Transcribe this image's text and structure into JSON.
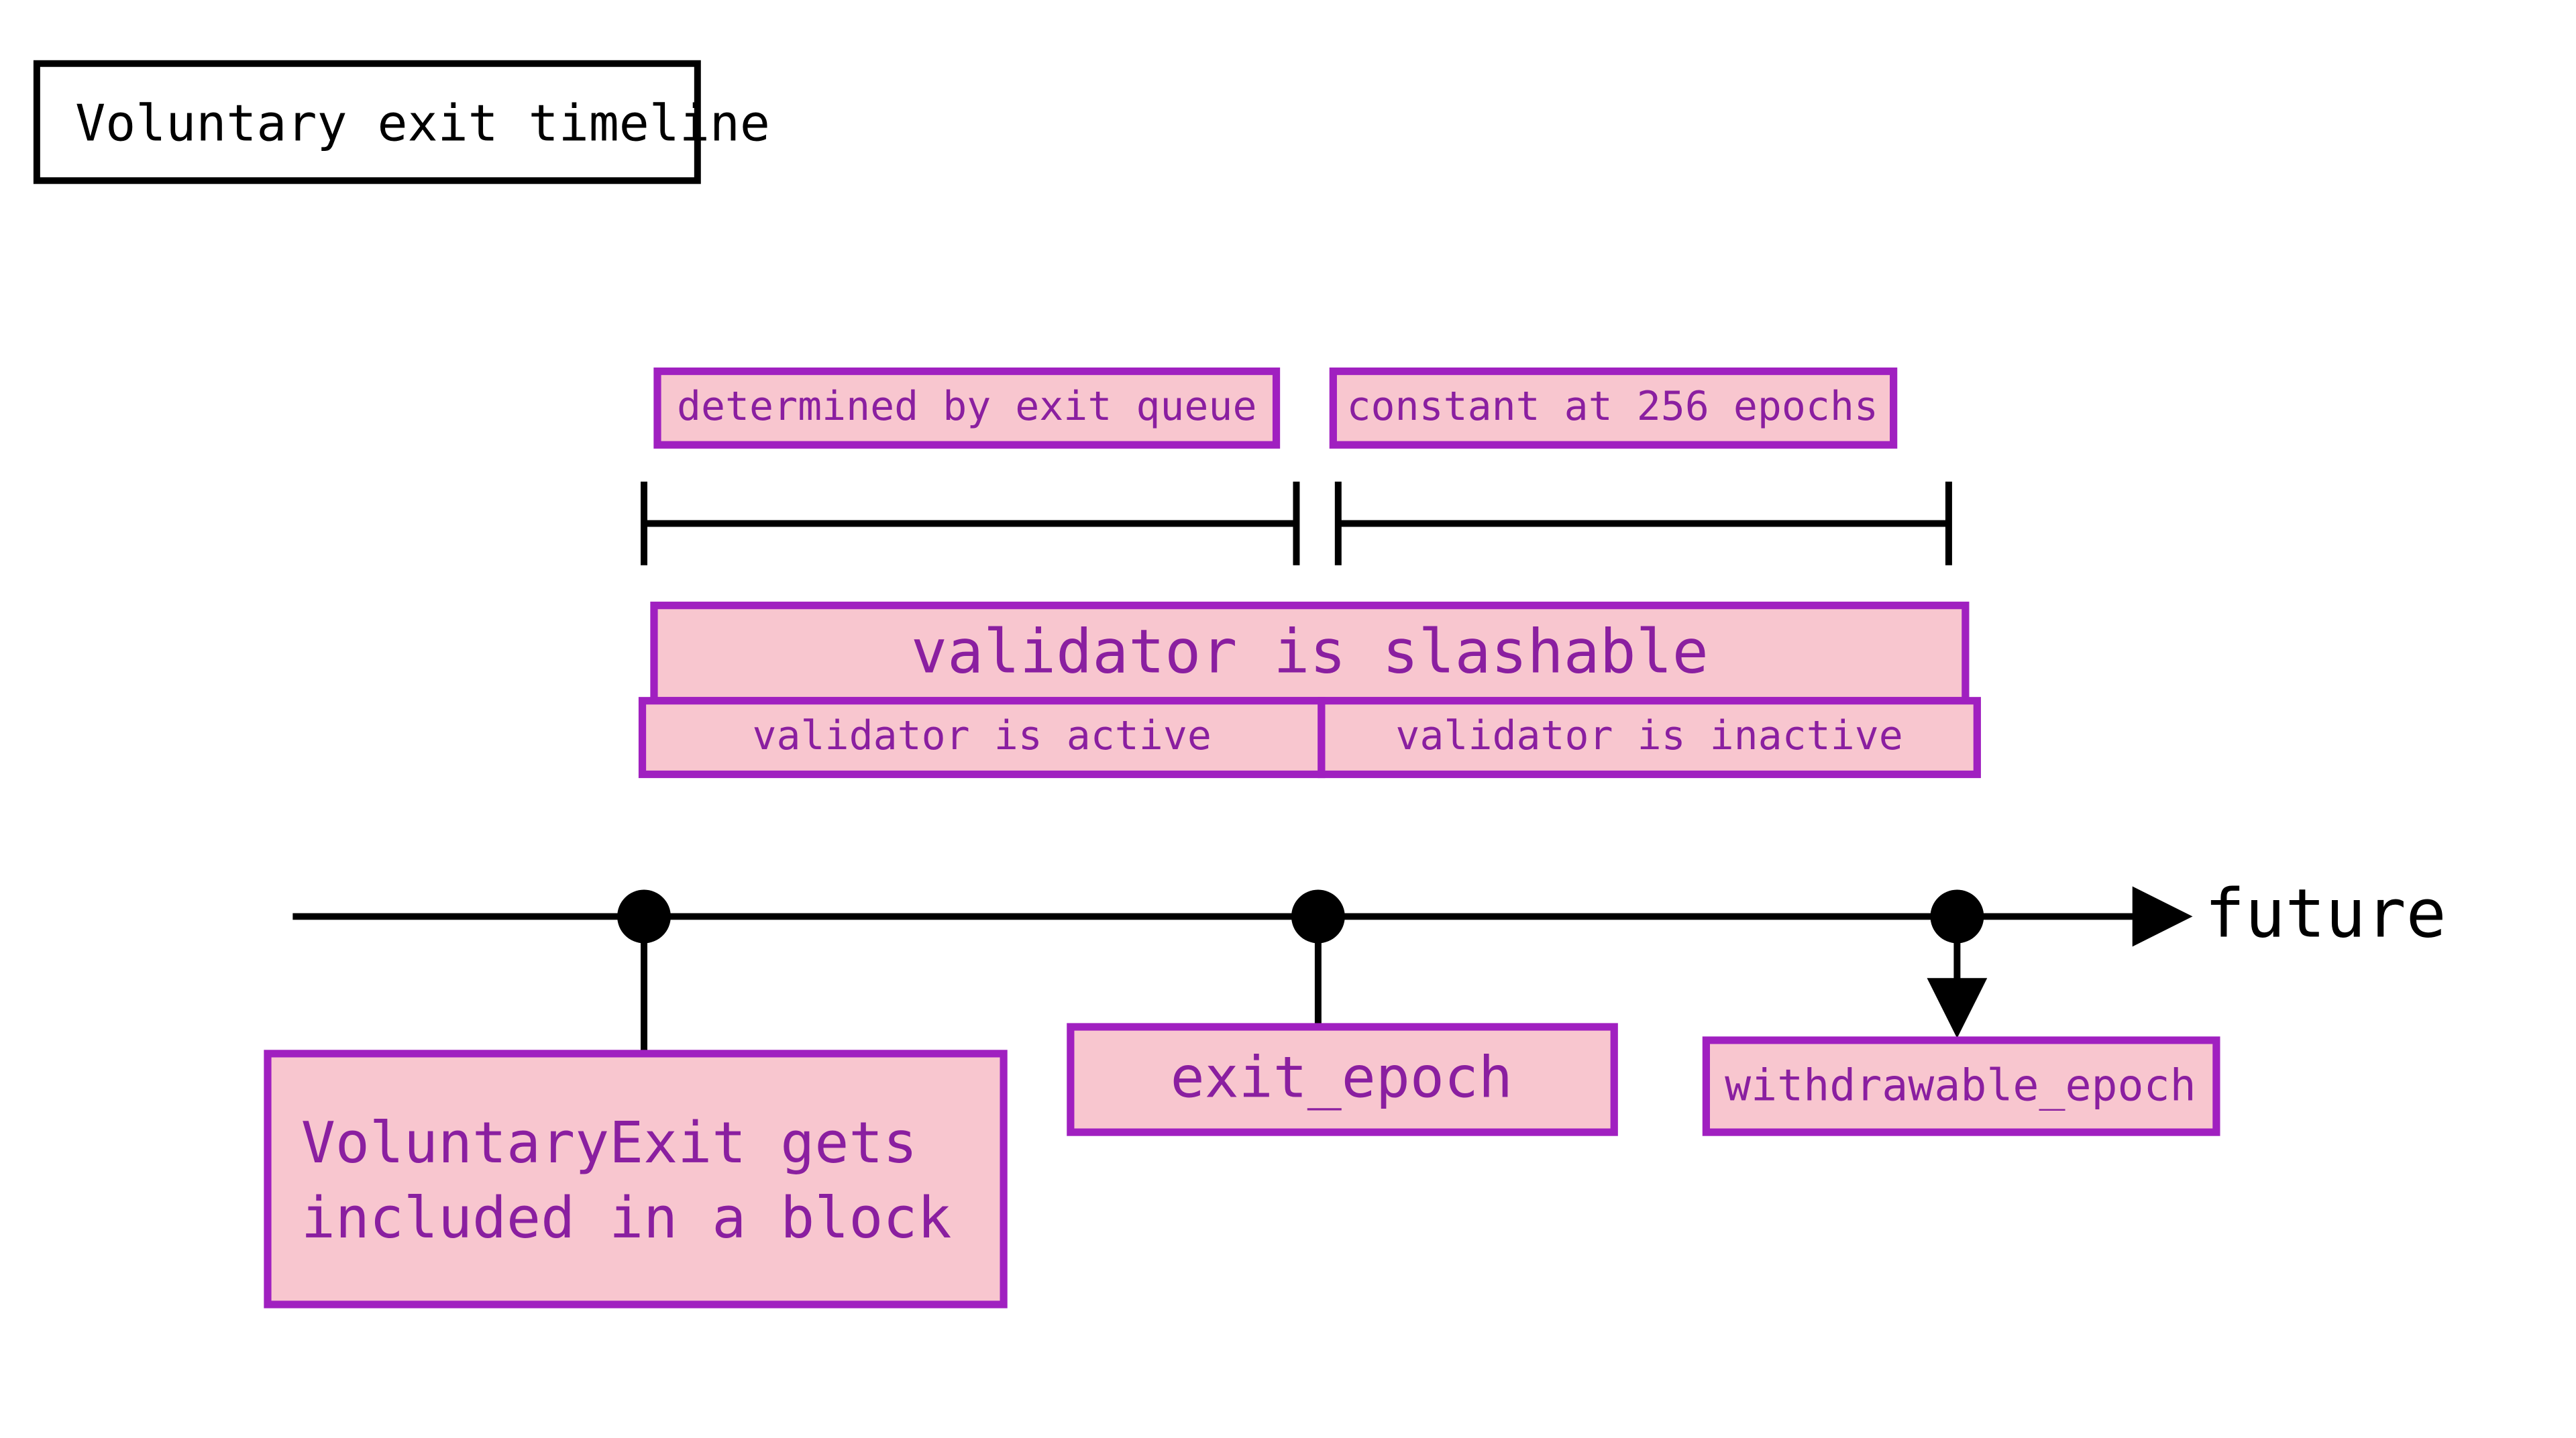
{
  "title": "Voluntary exit timeline",
  "future_label": "future",
  "intervals": {
    "left": "determined by exit queue",
    "right": "constant at 256 epochs"
  },
  "bands": {
    "slashable": "validator is slashable",
    "active": "validator is active",
    "inactive": "validator is inactive"
  },
  "events": {
    "included": "VoluntaryExit gets\nincluded in a block",
    "exit_epoch": "exit_epoch",
    "withdrawable": "withdrawable_epoch"
  }
}
